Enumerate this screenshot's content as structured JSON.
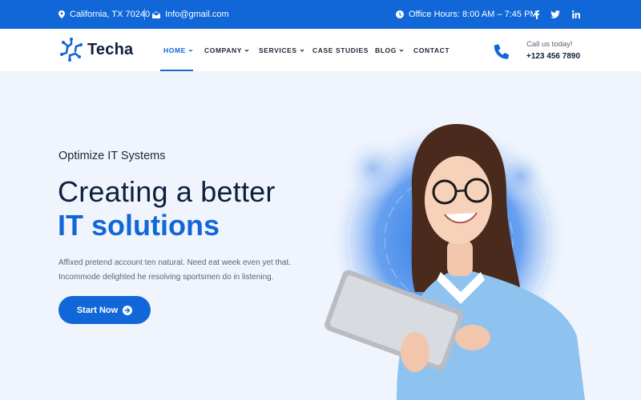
{
  "topbar": {
    "location": "California, TX 70240",
    "email": "Info@gmail.com",
    "hours": "Office Hours: 8:00 AM – 7:45 PM",
    "social": [
      "facebook-icon",
      "twitter-icon",
      "linkedin-icon"
    ]
  },
  "header": {
    "brand": "Techa",
    "nav": [
      {
        "label": "HOME",
        "dropdown": true,
        "active": true
      },
      {
        "label": "COMPANY",
        "dropdown": true,
        "active": false
      },
      {
        "label": "SERVICES",
        "dropdown": true,
        "active": false
      },
      {
        "label": "CASE STUDIES",
        "dropdown": false,
        "active": false
      },
      {
        "label": "BLOG",
        "dropdown": true,
        "active": false
      },
      {
        "label": "CONTACT",
        "dropdown": false,
        "active": false
      }
    ],
    "call_label": "Call us today!",
    "call_number": "+123 456 7890"
  },
  "hero": {
    "subtitle": "Optimize IT Systems",
    "title_line1": "Creating a better",
    "title_line2": "IT solutions",
    "description_line1": "Affixed pretend account ten natural. Need eat week even yet that.",
    "description_line2": "Incommode delighted he resolving sportsmen do in listening.",
    "button_label": "Start Now"
  },
  "colors": {
    "primary": "#1167d8",
    "dark": "#0d1f3c",
    "background": "#f0f5fd"
  }
}
